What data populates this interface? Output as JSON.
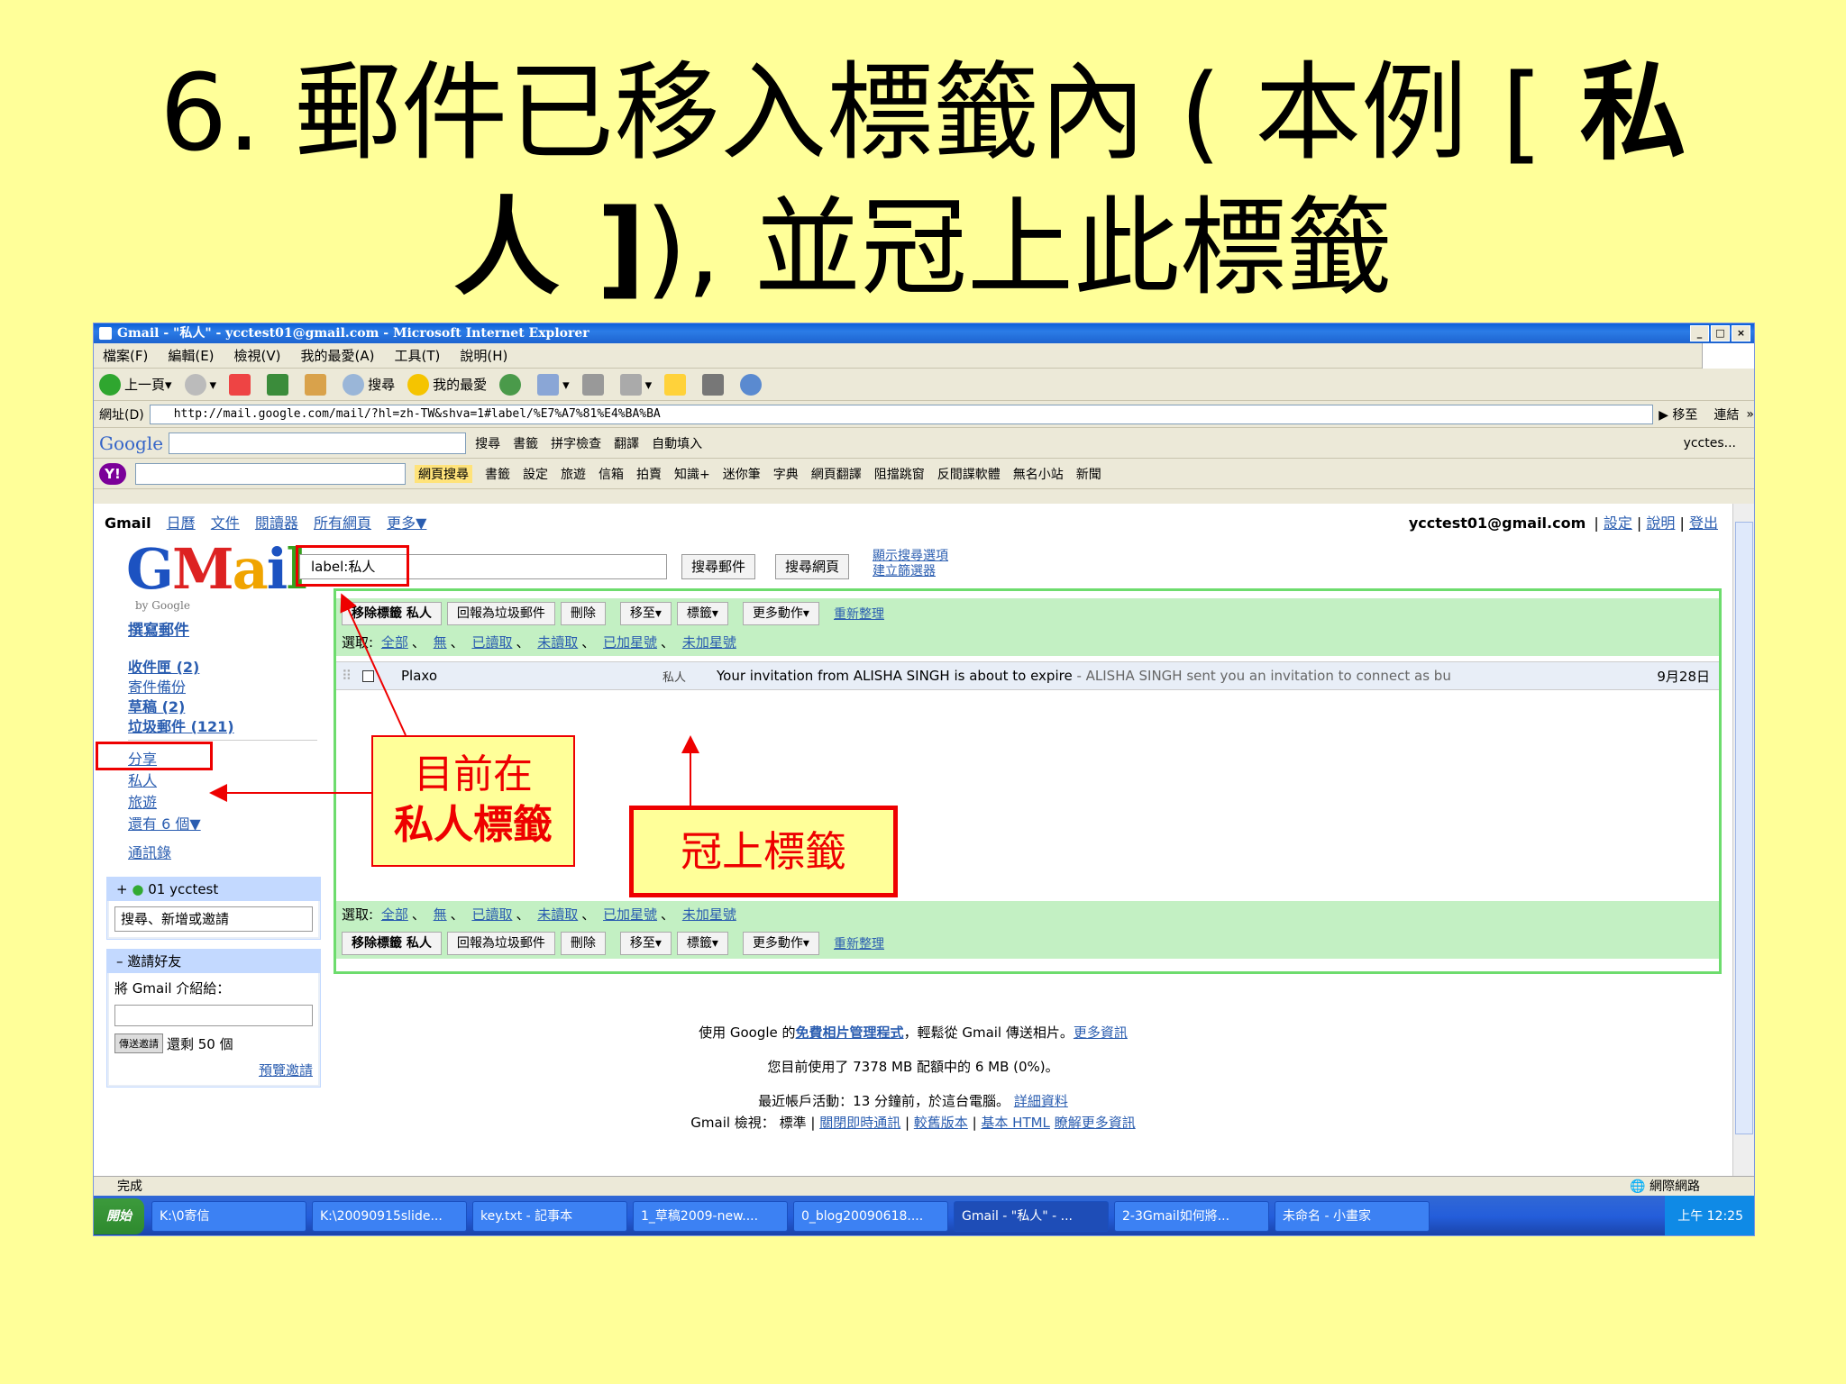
{
  "slide": {
    "title_line1": "6. 郵件已移入標籤內 ( 本例 [",
    "title_line1_bold": " 私",
    "title_line2_bold": "人 ]",
    "title_line2": "), 並冠上此標籤"
  },
  "window": {
    "title": "Gmail - \"私人\" - ycctest01@gmail.com - Microsoft Internet Explorer",
    "controls": [
      "_",
      "□",
      "×"
    ]
  },
  "menu": [
    "檔案(F)",
    "編輯(E)",
    "檢視(V)",
    "我的最愛(A)",
    "工具(T)",
    "說明(H)"
  ],
  "toolbar": {
    "back": "上一頁",
    "search": "搜尋",
    "favorites": "我的最愛"
  },
  "address": {
    "label": "網址(D)",
    "url": "http://mail.google.com/mail/?hl=zh-TW&shva=1#label/%E7%A7%81%E4%BA%BA",
    "go": "移至",
    "links": "連結"
  },
  "googlebar": {
    "logo": "Google",
    "items": [
      "搜尋",
      "書籤",
      "拼字檢查",
      "翻譯",
      "自動填入"
    ],
    "user": "ycctes..."
  },
  "yahoobar": {
    "logo": "Y!",
    "search_btn": "網頁搜尋",
    "items": [
      "書籤",
      "設定",
      "旅遊",
      "信箱",
      "拍賣",
      "知識+",
      "迷你筆",
      "字典",
      "網頁翻譯",
      "阻擋跳窗",
      "反間諜軟體",
      "無名小站",
      "新聞"
    ]
  },
  "gmail": {
    "topnav_brand": "Gmail",
    "topnav": [
      "日曆",
      "文件",
      "閱讀器",
      "所有網頁",
      "更多▼"
    ],
    "user_email": "ycctest01@gmail.com",
    "user_links": [
      "設定",
      "說明",
      "登出"
    ],
    "logo_by": "by Google",
    "search_value": "label:私人",
    "search_mail_btn": "搜尋郵件",
    "search_web_btn": "搜尋網頁",
    "show_options": "顯示搜尋選項",
    "create_filter": "建立篩選器",
    "compose": "撰寫郵件",
    "nav": [
      {
        "label": "收件匣 (2)",
        "bold": true
      },
      {
        "label": "寄件備份",
        "bold": false
      },
      {
        "label": "草稿 (2)",
        "bold": true
      },
      {
        "label": "垃圾郵件 (121)",
        "bold": true
      }
    ],
    "labels": [
      "分享",
      "私人",
      "旅遊",
      "還有 6 個▼"
    ],
    "contacts": "通訊錄",
    "chat": {
      "name": "01 ycctest",
      "search_placeholder": "搜尋、新增或邀請"
    },
    "invite": {
      "title": "邀請好友",
      "text": "將 Gmail 介紹給：",
      "send_btn": "傳送邀請",
      "remaining": "還剩 50 個",
      "preview": "預覽邀請"
    },
    "actions": {
      "remove_label": "移除標籤 私人",
      "report_spam": "回報為垃圾郵件",
      "delete": "刪除",
      "move_to": "移至▾",
      "labels": "標籤▾",
      "more": "更多動作▾",
      "refresh": "重新整理"
    },
    "select": {
      "label": "選取:",
      "options": [
        "全部",
        "無",
        "已讀取",
        "未讀取",
        "已加星號",
        "未加星號"
      ]
    },
    "messages": [
      {
        "sender": "Plaxo",
        "label": "私人",
        "subject": "Your invitation from ALISHA SINGH is about to expire",
        "snippet": " - ALISHA SINGH sent you an invitation to connect as bu",
        "date": "9月28日"
      }
    ],
    "footer": {
      "photo_pre": "使用 Google 的",
      "photo_link": "免費相片管理程式",
      "photo_post": "，輕鬆從 Gmail 傳送相片。",
      "more_info": "更多資訊",
      "quota": "您目前使用了 7378 MB 配額中的 6 MB (0%)。",
      "activity": "最近帳戶活動：13 分鐘前，於這台電腦。",
      "details": "詳細資料",
      "view_label": "Gmail 檢視：",
      "view_links": [
        "標準",
        "關閉即時通訊",
        "較舊版本",
        "基本 HTML"
      ],
      "learn_more": "瞭解更多資訊"
    }
  },
  "statusbar": {
    "done": "完成",
    "zone": "網際網路"
  },
  "taskbar": {
    "start": "開始",
    "tasks": [
      "K:\\0寄信",
      "K:\\20090915slide...",
      "key.txt - 記事本",
      "1_草稿2009-new....",
      "0_blog20090618....",
      "Gmail - \"私人\" - ...",
      "2-3Gmail如何將...",
      "未命名 - 小畫家"
    ],
    "clock": "上午 12:25"
  },
  "annotations": {
    "callout1_line1": "目前在",
    "callout1_line2": "私人標籤",
    "callout2": "冠上標籤"
  },
  "colors": {
    "slide_bg": "#ffff99",
    "highlight": "#e00000",
    "list_border": "#6ddc6d",
    "list_bar": "#c3f0c3"
  }
}
